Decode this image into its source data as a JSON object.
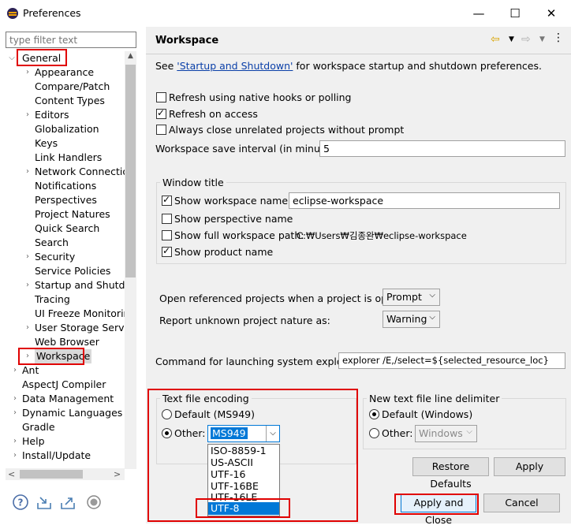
{
  "window": {
    "title": "Preferences",
    "minimize": "—",
    "maximize": "☐",
    "close": "✕"
  },
  "sidebar": {
    "filter_placeholder": "type filter text",
    "items": [
      {
        "label": "General"
      },
      {
        "label": "Appearance"
      },
      {
        "label": "Compare/Patch"
      },
      {
        "label": "Content Types"
      },
      {
        "label": "Editors"
      },
      {
        "label": "Globalization"
      },
      {
        "label": "Keys"
      },
      {
        "label": "Link Handlers"
      },
      {
        "label": "Network Connection"
      },
      {
        "label": "Notifications"
      },
      {
        "label": "Perspectives"
      },
      {
        "label": "Project Natures"
      },
      {
        "label": "Quick Search"
      },
      {
        "label": "Search"
      },
      {
        "label": "Security"
      },
      {
        "label": "Service Policies"
      },
      {
        "label": "Startup and Shutdow"
      },
      {
        "label": "Tracing"
      },
      {
        "label": "UI Freeze Monitoring"
      },
      {
        "label": "User Storage Service"
      },
      {
        "label": "Web Browser"
      },
      {
        "label": "Workspace"
      },
      {
        "label": "Ant"
      },
      {
        "label": "AspectJ Compiler"
      },
      {
        "label": "Data Management"
      },
      {
        "label": "Dynamic Languages"
      },
      {
        "label": "Gradle"
      },
      {
        "label": "Help"
      },
      {
        "label": "Install/Update"
      }
    ],
    "scroll_left": "<",
    "scroll_right": ">"
  },
  "page": {
    "title": "Workspace",
    "intro_prefix": "See ",
    "intro_link": "'Startup and Shutdown'",
    "intro_suffix": " for workspace startup and shutdown preferences.",
    "refresh_native": "Refresh using native hooks or polling",
    "refresh_access": "Refresh on access",
    "always_close": "Always close unrelated projects without prompt",
    "save_interval_label": "Workspace save interval (in minutes):",
    "save_interval_value": "5",
    "window_title_group": "Window title",
    "show_ws_name": "Show workspace name:",
    "ws_name_value": "eclipse-workspace",
    "show_perspective": "Show perspective name",
    "show_ws_path": "Show full workspace path:",
    "ws_path_value": "C:₩Users₩김종완₩eclipse-workspace",
    "show_product": "Show product name",
    "open_ref_label": "Open referenced projects when a project is opened:",
    "open_ref_value": "Prompt",
    "report_unknown_label": "Report unknown project nature as:",
    "report_unknown_value": "Warning",
    "cmd_label": "Command for launching system explorer:",
    "cmd_value": "explorer /E,/select=${selected_resource_loc}",
    "encoding_group": "Text file encoding",
    "enc_default": "Default (MS949)",
    "enc_other": "Other:",
    "enc_other_value": "MS949",
    "enc_options": [
      "ISO-8859-1",
      "US-ASCII",
      "UTF-16",
      "UTF-16BE",
      "UTF-16LE",
      "UTF-8"
    ],
    "delim_group": "New text file line delimiter",
    "delim_default": "Default (Windows)",
    "delim_other": "Other:",
    "delim_other_value": "Windows",
    "restore_defaults": "Restore Defaults",
    "apply": "Apply",
    "apply_close": "Apply and Close",
    "cancel": "Cancel"
  },
  "colors": {
    "highlight": "#e00000",
    "selection": "#0078d7",
    "link": "#0a3fa8"
  }
}
